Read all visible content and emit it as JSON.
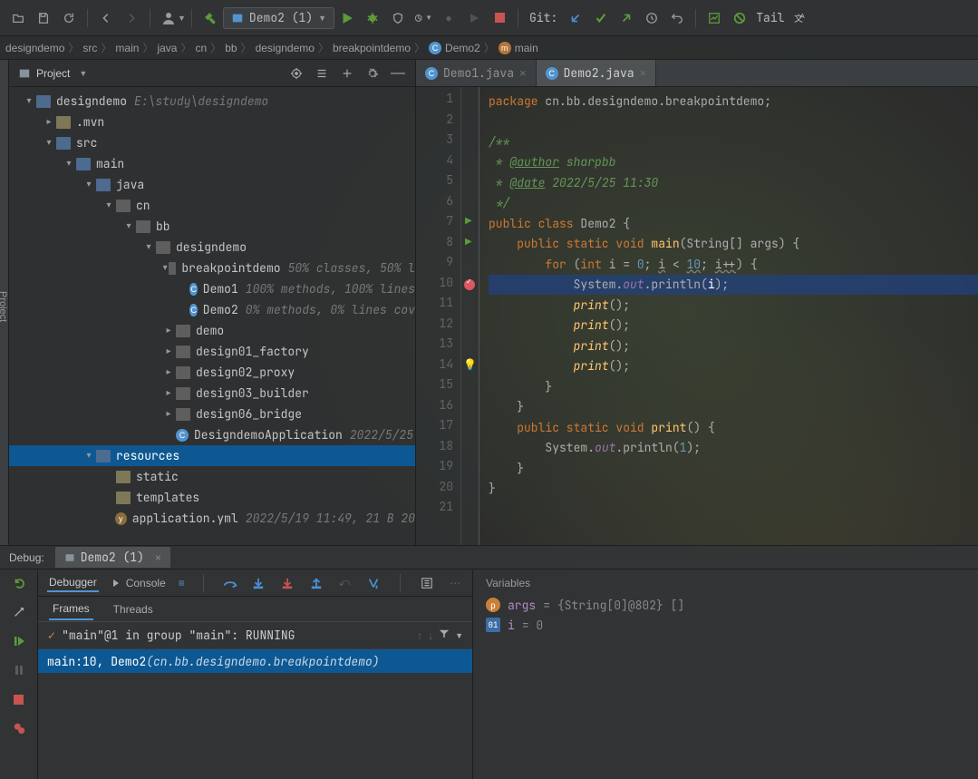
{
  "toolbar": {
    "run_config": "Demo2 (1)",
    "git_label": "Git:",
    "tail_label": "Tail"
  },
  "breadcrumbs": [
    "designdemo",
    "src",
    "main",
    "java",
    "cn",
    "bb",
    "designdemo",
    "breakpointdemo",
    "Demo2",
    "main"
  ],
  "project": {
    "panel_title": "Project",
    "root_name": "designdemo",
    "root_path": "E:\\study\\designdemo",
    "tree": [
      {
        "d": 0,
        "exp": "down",
        "icon": "proj",
        "label": "designdemo",
        "suffix": "E:\\study\\designdemo"
      },
      {
        "d": 1,
        "exp": "right",
        "icon": "folder",
        "label": ".mvn"
      },
      {
        "d": 1,
        "exp": "down",
        "icon": "blue",
        "label": "src"
      },
      {
        "d": 2,
        "exp": "down",
        "icon": "blue",
        "label": "main"
      },
      {
        "d": 3,
        "exp": "down",
        "icon": "blue",
        "label": "java"
      },
      {
        "d": 4,
        "exp": "down",
        "icon": "pkg",
        "label": "cn"
      },
      {
        "d": 5,
        "exp": "down",
        "icon": "pkg",
        "label": "bb"
      },
      {
        "d": 6,
        "exp": "down",
        "icon": "pkg",
        "label": "designdemo"
      },
      {
        "d": 7,
        "exp": "down",
        "icon": "pkg",
        "label": "breakpointdemo",
        "suffix": "50% classes, 50% l"
      },
      {
        "d": 8,
        "exp": "",
        "icon": "class",
        "label": "Demo1",
        "suffix": "100% methods, 100% lines"
      },
      {
        "d": 8,
        "exp": "",
        "icon": "class",
        "label": "Demo2",
        "suffix": "0% methods, 0% lines cov"
      },
      {
        "d": 7,
        "exp": "right",
        "icon": "pkg",
        "label": "demo"
      },
      {
        "d": 7,
        "exp": "right",
        "icon": "pkg",
        "label": "design01_factory"
      },
      {
        "d": 7,
        "exp": "right",
        "icon": "pkg",
        "label": "design02_proxy"
      },
      {
        "d": 7,
        "exp": "right",
        "icon": "pkg",
        "label": "design03_builder"
      },
      {
        "d": 7,
        "exp": "right",
        "icon": "pkg",
        "label": "design06_bridge"
      },
      {
        "d": 7,
        "exp": "",
        "icon": "class",
        "label": "DesigndemoApplication",
        "suffix": "2022/5/25"
      },
      {
        "d": 3,
        "exp": "down",
        "icon": "blue",
        "label": "resources",
        "selected": true
      },
      {
        "d": 4,
        "exp": "",
        "icon": "folder",
        "label": "static"
      },
      {
        "d": 4,
        "exp": "",
        "icon": "folder",
        "label": "templates"
      },
      {
        "d": 4,
        "exp": "",
        "icon": "yml",
        "label": "application.yml",
        "suffix": "2022/5/19 11:49, 21 B 20"
      }
    ]
  },
  "editor": {
    "tabs": [
      {
        "name": "Demo1.java",
        "active": false
      },
      {
        "name": "Demo2.java",
        "active": true
      }
    ],
    "lines": [
      {
        "n": 1,
        "html": "<span class='kw'>package</span> cn.bb.designdemo.breakpointdemo;"
      },
      {
        "n": 2,
        "html": ""
      },
      {
        "n": 3,
        "html": "<span class='doc'>/**</span>"
      },
      {
        "n": 4,
        "html": "<span class='doc'> * <span class='doctag'>@author</span> sharpbb</span>"
      },
      {
        "n": 5,
        "html": "<span class='doc'> * <span class='doctag'>@date</span> 2022/5/25 11:30</span>"
      },
      {
        "n": 6,
        "html": "<span class='doc'> */</span>"
      },
      {
        "n": 7,
        "run": true,
        "html": "<span class='kw'>public class</span> Demo2 {"
      },
      {
        "n": 8,
        "run": true,
        "html": "    <span class='kw'>public static void</span> <span class='fn' style='font-style:normal'>main</span>(String[] args) {"
      },
      {
        "n": 9,
        "html": "        <span class='kw'>for</span> (<span class='kw'>int</span> i = <span class='num'>0</span>; <span class='warn-u'>i</span> &lt; <span class='num warn-u'>10</span>; <span class='warn-u'>i++</span>) {"
      },
      {
        "n": 10,
        "bp": true,
        "hl": true,
        "html": "            System.<span class='fld'>out</span>.println(<span style='color:#fff'>i</span>);"
      },
      {
        "n": 11,
        "html": "            <span class='fn'>print</span>();"
      },
      {
        "n": 12,
        "html": "            <span class='fn'>print</span>();"
      },
      {
        "n": 13,
        "html": "            <span class='fn'>print</span>();"
      },
      {
        "n": 14,
        "bulb": true,
        "html": "            <span class='fn'>print</span>();"
      },
      {
        "n": 15,
        "html": "        }"
      },
      {
        "n": 16,
        "html": "    }"
      },
      {
        "n": 17,
        "html": "    <span class='kw'>public static void</span> <span class='fn' style='font-style:normal'>print</span>() {"
      },
      {
        "n": 18,
        "html": "        System.<span class='fld'>out</span>.println(<span class='num'>1</span>);"
      },
      {
        "n": 19,
        "html": "    }"
      },
      {
        "n": 20,
        "html": "}"
      },
      {
        "n": 21,
        "html": ""
      }
    ]
  },
  "debug": {
    "label": "Debug:",
    "tab": "Demo2 (1)",
    "tools": {
      "debugger": "Debugger",
      "console": "Console"
    },
    "frames_tab": "Frames",
    "threads_tab": "Threads",
    "vars_title": "Variables",
    "stack_header": "\"main\"@1 in group \"main\": RUNNING",
    "stack_row_prefix": "main:10, Demo2 ",
    "stack_row_loc": "(cn.bb.designdemo.breakpointdemo)",
    "vars": [
      {
        "badge": "p",
        "name": "args",
        "value": "= {String[0]@802} []"
      },
      {
        "badge": "01",
        "name": "i",
        "value": "= 0"
      }
    ]
  }
}
